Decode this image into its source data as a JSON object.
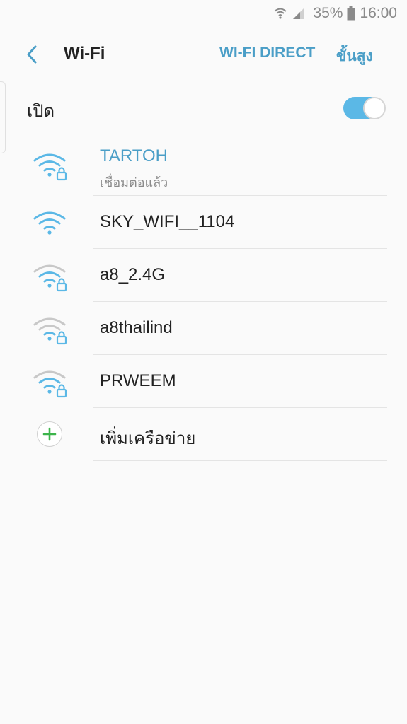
{
  "status_bar": {
    "battery_percent": "35%",
    "time": "16:00",
    "icons": [
      "wifi-signal-icon",
      "cell-signal-icon",
      "battery-icon"
    ]
  },
  "app_bar": {
    "title": "Wi-Fi",
    "wifi_direct_label": "WI-FI DIRECT",
    "advanced_label": "ขั้นสูง"
  },
  "wifi_toggle": {
    "label": "เปิด",
    "state": "on"
  },
  "networks": [
    {
      "name": "TARTOH",
      "status": "เชื่อมต่อแล้ว",
      "secured": true,
      "connected": true
    },
    {
      "name": "SKY_WIFI__1104",
      "secured": false,
      "connected": false
    },
    {
      "name": "a8_2.4G",
      "secured": true,
      "connected": false
    },
    {
      "name": "a8thailind",
      "secured": true,
      "connected": false
    },
    {
      "name": "PRWEEM",
      "secured": true,
      "connected": false
    }
  ],
  "add_network": {
    "label": "เพิ่มเครือข่าย"
  },
  "colors": {
    "accent": "#4a9ec7",
    "toggle_on": "#5bb8e6",
    "wifi_strong": "#5bb8e6",
    "wifi_weak": "#c8c8c8",
    "add_plus": "#3cb44b"
  }
}
